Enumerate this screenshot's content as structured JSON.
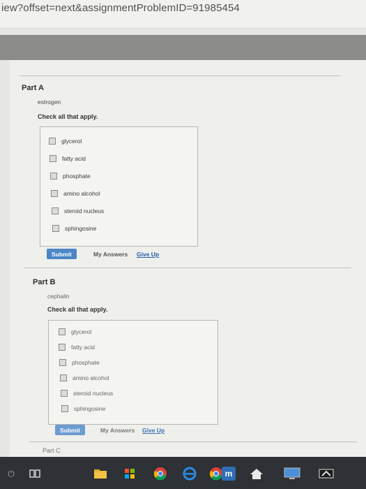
{
  "browser": {
    "url_fragment": "iew?offset=next&assignmentProblemID=91985454"
  },
  "partA": {
    "title": "Part A",
    "term": "estrogen",
    "instruction": "Check all that apply.",
    "options": [
      "glycerol",
      "fatty acid",
      "phosphate",
      "amino alcohol",
      "steroid nucleus",
      "sphingosine"
    ],
    "submit_label": "Submit",
    "my_answers_label": "My Answers",
    "give_up_label": "Give Up"
  },
  "partB": {
    "title": "Part B",
    "term": "cephalin",
    "instruction": "Check all that apply.",
    "options": [
      "glycerol",
      "fatty acid",
      "phosphate",
      "amino alcohol",
      "steroid nucleus",
      "sphingosine"
    ],
    "submit_label": "Submit",
    "my_answers_label": "My Answers",
    "give_up_label": "Give Up"
  },
  "partC": {
    "title": "Part C"
  },
  "taskbar": {
    "icons": [
      "power-icon",
      "task-view-icon",
      "folder-icon",
      "store-icon",
      "chrome-icon",
      "ie-icon",
      "chrome-icon",
      "mail-icon",
      "home-icon",
      "monitor-icon",
      "network-icon"
    ]
  },
  "colors": {
    "accent": "#4a86c6",
    "link": "#1f5fa8",
    "taskbar": "#2e3135"
  }
}
